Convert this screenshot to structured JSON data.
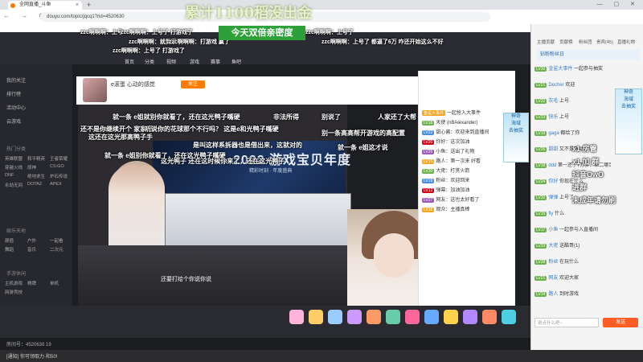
{
  "browser": {
    "tab_title": "全网直播_斗鱼",
    "tab_close": "×",
    "new_tab": "+",
    "window_controls": "— ▢ ✕",
    "nav_buttons": "← → ⟳",
    "url": "douyu.com/topic/jqcq1?rid=4520630"
  },
  "overlay": {
    "big_title": "累计1100稻没出金",
    "double_badge": "今天双倍亲密度"
  },
  "top_danmu": [
    "zzc啊啊啊：上号",
    "zzc啊啊啊：上号了 打游戏了",
    "zzc啊啊啊：上号了",
    "zzc啊啊啊：就到家了",
    "zzc啊啊啊：打游戏 赢了",
    "zzc啊啊啊：上号了 都逼了6万 咋还开始这么不好",
    "zzc啊啊啊：上号了 打游戏了"
  ],
  "header": {
    "nav_items": [
      "首页",
      "分类",
      "视频",
      "游戏",
      "赛事",
      "鱼吧"
    ]
  },
  "sidebar": {
    "items": [
      "我的关注",
      "排行榜",
      "活动中心",
      "云游戏"
    ],
    "section1": "热门分类",
    "grid1": [
      "英雄联盟",
      "和平精英",
      "王者荣耀",
      "穿越火线",
      "原神",
      "CS:GO",
      "DNF",
      "绝地求生",
      "炉石传说",
      "永劫无间",
      "DOTA2",
      "APEX"
    ],
    "section2": "娱乐天地",
    "grid2": [
      "颜值",
      "户外",
      "一起看",
      "舞蹈",
      "音乐",
      "二次元"
    ],
    "section3": "手游休闲",
    "grid3": [
      "主机游戏",
      "棋牌",
      "单机",
      "网游竞技"
    ]
  },
  "streamer": {
    "title": "e滚蛋 心动的感觉",
    "follow_label": "关注"
  },
  "video": {
    "banner_year": "2022 游戏宝贝年度",
    "banner_sub": "精彩时刻 · 年度盛典",
    "subtitle": "还要打给个你说你说"
  },
  "video_danmu": [
    "就一条 e姐就别你就看了，还在这光鸭子嘴硬",
    "非法所得",
    "别说了",
    "人家还了大帮",
    "还不是你继续开个 家家过",
    "听说你的花球那个不行吗？ 这是e和光鸭子嘴硬",
    "这还在这光那高鸭子手",
    "是叫这样系拆器也是借出来，这就对的",
    "别一条高高帮开游戏的高配置",
    "就一条 e姐这才说",
    "这光鸭子 还在这时候你来了，还在这光鸭子",
    "就一条 e姐别你就看了，还在这光鸭子嘴硬"
  ],
  "chat_panel": {
    "rows": [
      {
        "badge": "金鲨大事件",
        "text": "一起抢入大事件"
      },
      {
        "badge": "LV18",
        "text": "天使 (nBAlexander)"
      },
      {
        "badge": "LV22",
        "text": "甜心酱：欢迎来到直播间"
      },
      {
        "badge": "LV20",
        "text": "你好：这次加油"
      },
      {
        "badge": "LV25",
        "text": "小鱼：送出了礼物"
      },
      {
        "badge": "LV15",
        "text": "路人：第一次来 好看"
      },
      {
        "badge": "LV30",
        "text": "大佬：打赏火箭"
      },
      {
        "badge": "LV19",
        "text": "粉丝：欢迎回来"
      },
      {
        "badge": "LV12",
        "text": "弹幕：加油加油"
      },
      {
        "badge": "LV27",
        "text": "网友：这也太好看了"
      },
      {
        "badge": "LV16",
        "text": "观众：主播真棒"
      }
    ]
  },
  "ad_tile": {
    "line1": "神奇",
    "line2": "海域",
    "line3": "去抽奖"
  },
  "gift_count": 12,
  "status": {
    "uid_text": "房间号：4520630 19",
    "bottom_text": "[通知] 你可领取力·和50!"
  },
  "right_panel": {
    "tabs": [
      "主播贡献",
      "贡献榜",
      "粉丝团",
      "贵宾(45)",
      "直播礼物"
    ],
    "header_label": "钻粉粉丝日",
    "rows": [
      {
        "lv": "LV30",
        "name": "金鲨大事件",
        "text": "一起参与抽奖"
      },
      {
        "lv": "LV21",
        "name": "Decher",
        "text": "欢迎"
      },
      {
        "lv": "LV22",
        "name": "灰毛",
        "text": "上号"
      },
      {
        "lv": "LV23",
        "name": "快乐",
        "text": "上号"
      },
      {
        "lv": "LV19",
        "name": "gaga",
        "text": "都给了你"
      },
      {
        "lv": "LV26",
        "name": "甜甜",
        "text": "又不是下动是"
      },
      {
        "lv": "LV18",
        "name": "ddd",
        "text": "第一还了7万多，第二哪足百调好了"
      },
      {
        "lv": "LV24",
        "name": "你好",
        "text": "你现在什么"
      },
      {
        "lv": "LV20",
        "name": "弹弹",
        "text": "上号了"
      },
      {
        "lv": "LV15",
        "name": "fly",
        "text": "什么"
      },
      {
        "lv": "LV17",
        "name": "小鱼",
        "text": "一起参与入直播间"
      },
      {
        "lv": "LV33",
        "name": "大佬",
        "text": "送酷哥(1)"
      },
      {
        "lv": "LV28",
        "name": "粉丝",
        "text": "在玩什么"
      },
      {
        "lv": "LV21",
        "name": "网友",
        "text": "欢迎大家"
      },
      {
        "lv": "LV14",
        "name": "路人",
        "text": "到时游戏"
      }
    ],
    "overlay_lines": [
      "x1 房管",
      "x1 加 群",
      "抖音OwO",
      "进群",
      "未成年请勿刷"
    ],
    "ad_tile": {
      "line1": "神奇",
      "line2": "海域",
      "line3": "去抽奖"
    },
    "input_placeholder": "说点什么吧~",
    "send_label": "发送"
  }
}
